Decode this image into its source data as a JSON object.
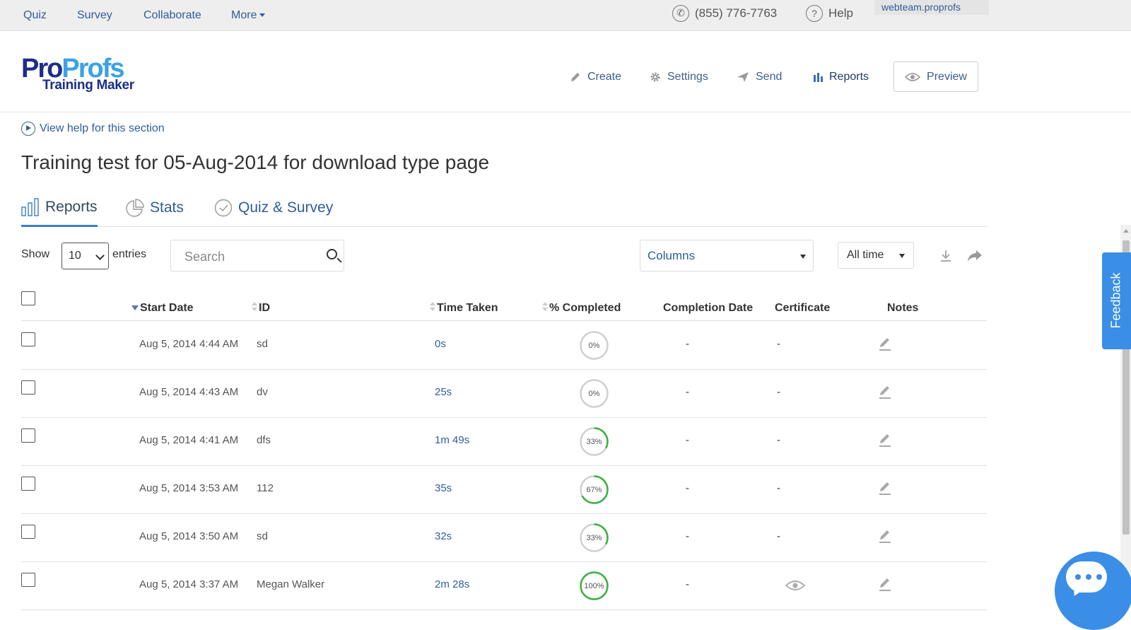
{
  "topbar": {
    "nav": [
      "Quiz",
      "Survey",
      "Collaborate",
      "More"
    ],
    "phone": "(855) 776-7763",
    "help": "Help",
    "account": "webteam.proprofs"
  },
  "logo": {
    "part1": "Pro",
    "part2": "Profs",
    "sub": "Training Maker"
  },
  "header_nav": {
    "create": "Create",
    "settings": "Settings",
    "send": "Send",
    "reports": "Reports",
    "preview": "Preview"
  },
  "help_link": "View help for this section",
  "page_title": "Training test for 05-Aug-2014 for download type page",
  "tabs": [
    "Reports",
    "Stats",
    "Quiz & Survey"
  ],
  "toolbar": {
    "show": "Show",
    "entries_value": "10",
    "entries": "entries",
    "search_placeholder": "Search",
    "columns": "Columns",
    "time_filter": "All time"
  },
  "table": {
    "headers": {
      "start_date": "Start Date",
      "id": "ID",
      "time_taken": "Time Taken",
      "completed": "% Completed",
      "completion_date": "Completion Date",
      "certificate": "Certificate",
      "notes": "Notes"
    },
    "rows": [
      {
        "start_date": "Aug 5, 2014 4:44 AM",
        "id": "sd",
        "time_taken": "0s",
        "completed_label": "0%",
        "completed": 0,
        "completion_date": "-",
        "certificate": "-"
      },
      {
        "start_date": "Aug 5, 2014 4:43 AM",
        "id": "dv",
        "time_taken": "25s",
        "completed_label": "0%",
        "completed": 0,
        "completion_date": "-",
        "certificate": "-"
      },
      {
        "start_date": "Aug 5, 2014 4:41 AM",
        "id": "dfs",
        "time_taken": "1m 49s",
        "completed_label": "33%",
        "completed": 33,
        "completion_date": "-",
        "certificate": "-"
      },
      {
        "start_date": "Aug 5, 2014 3:53 AM",
        "id": "112",
        "time_taken": "35s",
        "completed_label": "67%",
        "completed": 67,
        "completion_date": "-",
        "certificate": "-"
      },
      {
        "start_date": "Aug 5, 2014 3:50 AM",
        "id": "sd",
        "time_taken": "32s",
        "completed_label": "33%",
        "completed": 33,
        "completion_date": "-",
        "certificate": "-"
      },
      {
        "start_date": "Aug 5, 2014 3:37 AM",
        "id": "Megan Walker",
        "time_taken": "2m 28s",
        "completed_label": "100%",
        "completed": 100,
        "completion_date": "-",
        "certificate": "eye-icon"
      }
    ]
  },
  "feedback": "Feedback",
  "colors": {
    "link": "#2f5d99",
    "accent": "#3a8ee6",
    "progress": "#3cb043",
    "track": "#d0d0d0"
  }
}
